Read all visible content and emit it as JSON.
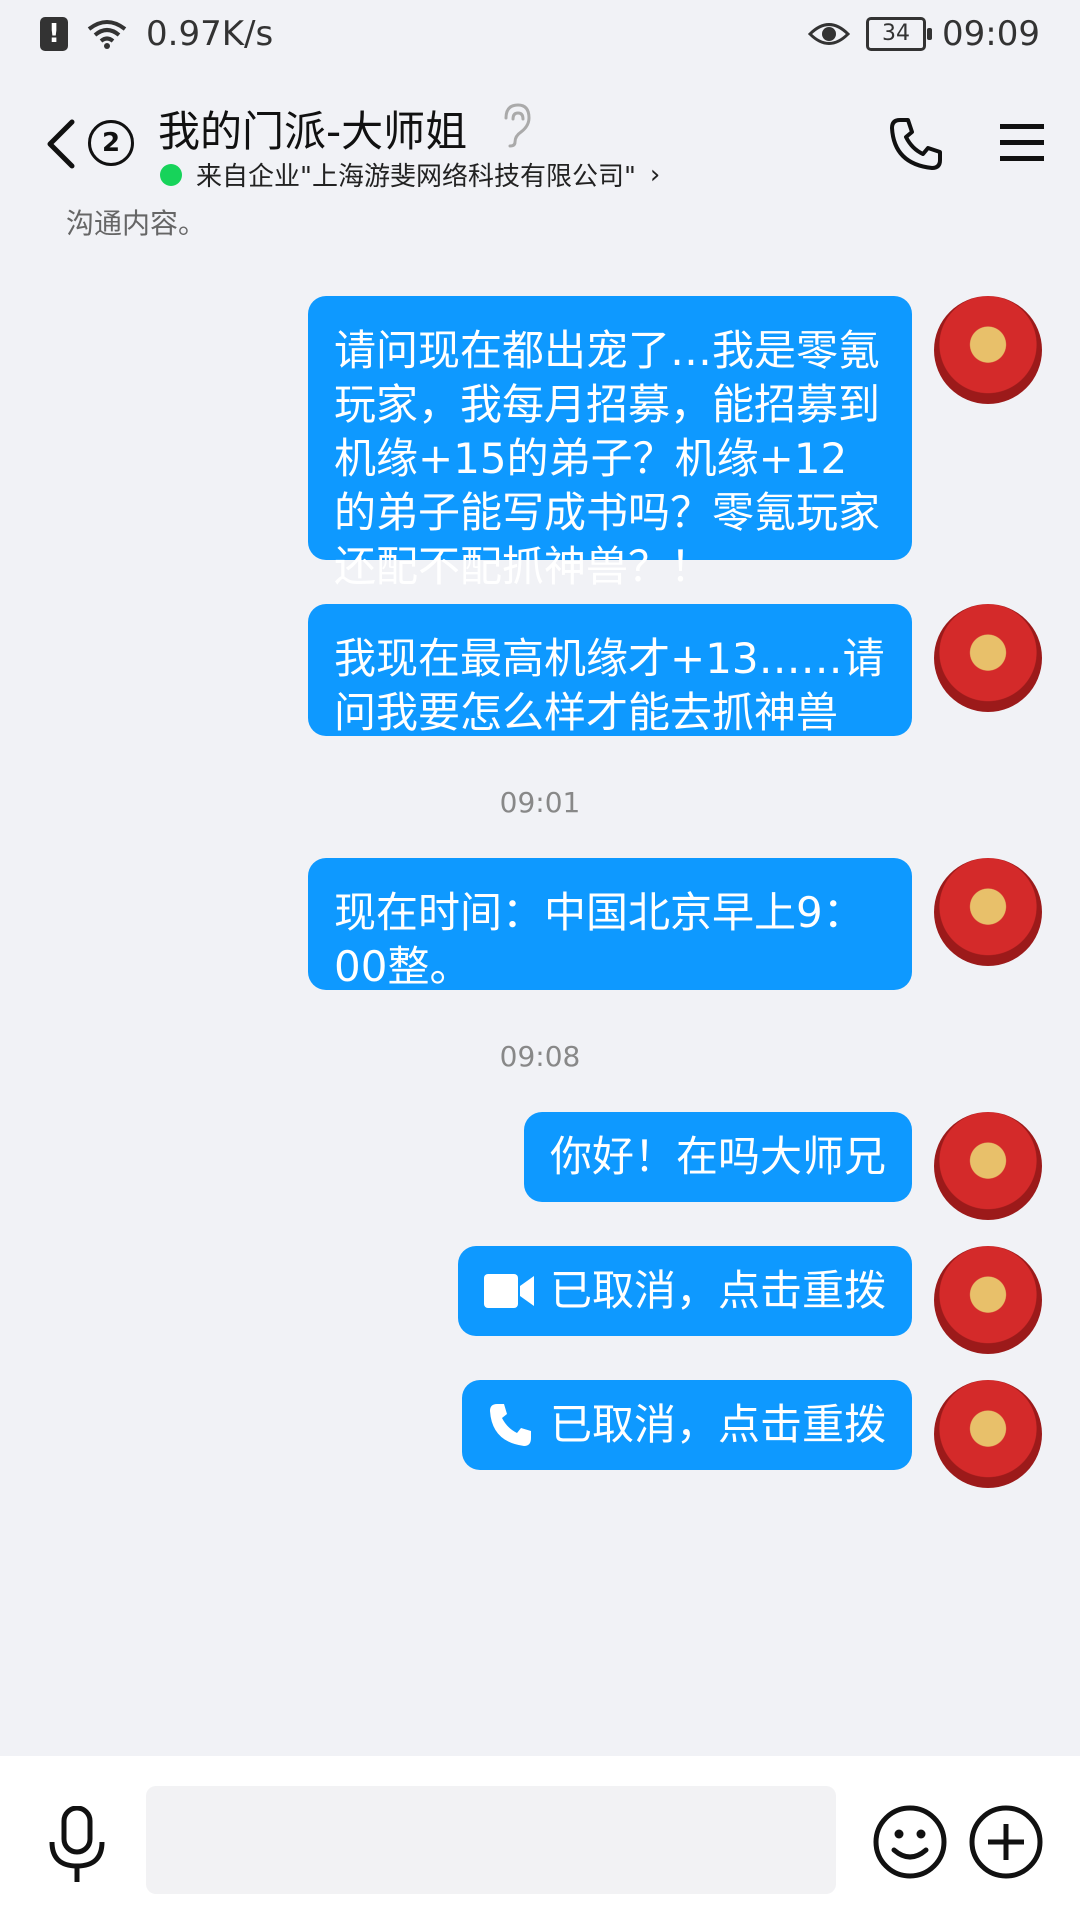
{
  "status_bar": {
    "alert_icon": "alert-icon",
    "network_speed": "0.97K/s",
    "battery_level": "34",
    "time": "09:09"
  },
  "header": {
    "back_badge": "2",
    "title": "我的门派-大师姐",
    "subtitle": "来自企业\"上海游斐网络科技有限公司\"",
    "subtitle_chevron": "›",
    "online_color": "#17d35a"
  },
  "chat": {
    "cut_off_text": "沟通内容。",
    "messages": [
      {
        "text": "请问现在都出宠了…我是零氪玩家，我每月招募，能招募到机缘+15的弟子？机缘+12的弟子能写成书吗？零氪玩家还配不配抓神兽？！"
      },
      {
        "text": "我现在最高机缘才+13……请问我要怎么样才能去抓神兽"
      },
      {
        "time": "09:01"
      },
      {
        "text": "现在时间：中国北京早上9：00整。"
      },
      {
        "time": "09:08"
      },
      {
        "text": "你好！在吗大师兄"
      },
      {
        "call_text": "已取消，点击重拨",
        "call_icon": "video-camera-icon"
      },
      {
        "call_text": "已取消，点击重拨",
        "call_icon": "phone-icon"
      }
    ],
    "bubble_color": "#0e99ff"
  },
  "input_bar": {
    "placeholder": ""
  }
}
